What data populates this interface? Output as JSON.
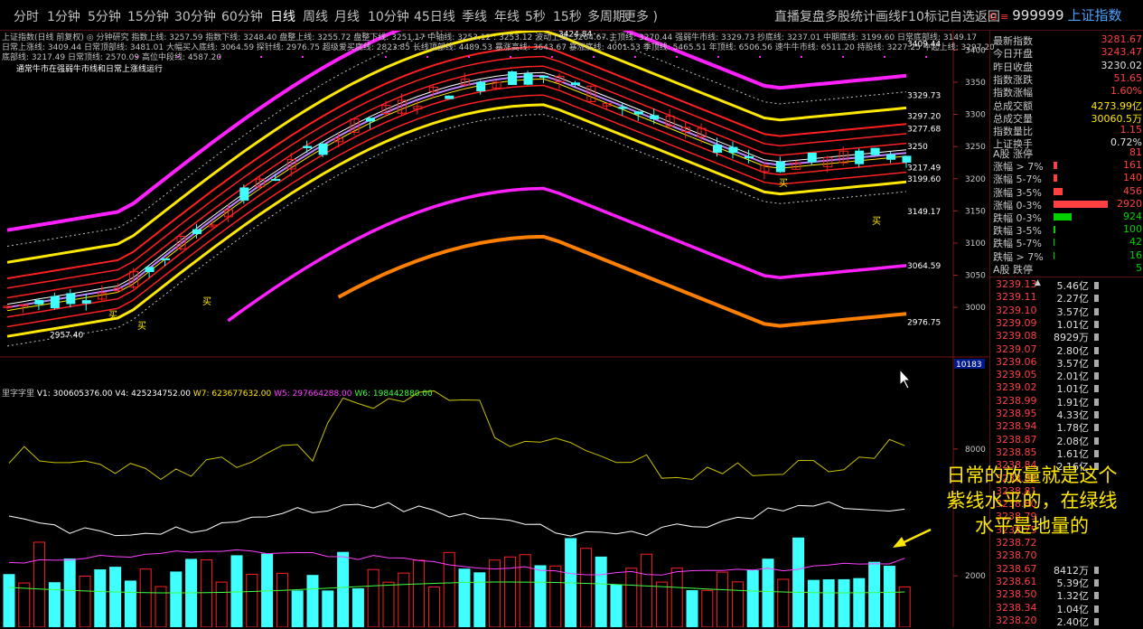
{
  "topbar": {
    "tabs": [
      "分时",
      "1分钟",
      "5分钟",
      "15分钟",
      "30分钟",
      "60分钟",
      "日线",
      "周线",
      "月线",
      "10分钟",
      "45日线",
      "季线",
      "年线",
      "5秒",
      "15秒",
      "多周期",
      "更多 )"
    ],
    "active_tab": "日线",
    "tools_text": "直播复盘多股统计画线F10标记自选返回"
  },
  "stock": {
    "flag": "G ≡",
    "code": "999999",
    "name": "上证指数"
  },
  "indicator": {
    "line1": "上证指数(日线 前复权) ◎ 分钟研究  指数上线: 3257.59  指数下线: 3248.40  盘整上线: 3255.72  盘整下线: 3251.17  中轴线: 3253.12 : 3253.12  波动上线: 3264.67  主顶线: 3270.44  强弱牛市线: 3329.73  抄底线: 3237.01  中期底线: 3199.60  日常底部线: 3149.17",
    "line2": "日常上涨线: 3409.44  日常顶部线: 3481.01  大幅买入底线: 3064.59  探针线: 2976.75  超级爱买底线: 2823.85  长线顶部线: 4489.53  暴涨高线: 3643.67  暴涨底线: 4001.53  季顶线: 5465.51  年顶线: 6506.56  速牛牛市线: 6511.20  持股线: 3227.25  牛起上线: 3297.20",
    "line3": "底部线: 3217.49  日常顶线: 2570.09  高位中段线: 4587.20",
    "note": "通常牛市在强弱牛市线和日常上涨线运行",
    "high_label": "3424.84",
    "low_label": "2957.40"
  },
  "volume_indicator": {
    "name": "里字字里",
    "v1": "V1: 300605376.00",
    "v4": "V4: 425234752.00",
    "w7": "W7: 623677632.00",
    "w5": "W5: 297664288.00",
    "w6": "W6: 198442880.00",
    "scale_box": "10183"
  },
  "price_levels": [
    "3409.44",
    "3329.73",
    "3297.20",
    "3277.68",
    "3250",
    "3217.49",
    "3199.60",
    "3149.17",
    "3064.59",
    "2976.75"
  ],
  "price_axis": [
    "3400",
    "3350",
    "3300",
    "3250",
    "3200",
    "3150",
    "3100",
    "3050",
    "3000"
  ],
  "vol_axis": [
    "8000",
    "2000"
  ],
  "right_panel": {
    "rows": [
      {
        "l": "最新指数",
        "v": "3281.67",
        "c": "#ff4040"
      },
      {
        "l": "今日开盘",
        "v": "3243.47",
        "c": "#ff4040"
      },
      {
        "l": "昨日收盘",
        "v": "3230.02",
        "c": "#e0e0e0"
      },
      {
        "l": "指数涨跌",
        "v": "51.65",
        "c": "#ff4040"
      },
      {
        "l": "指数涨幅",
        "v": "1.60%",
        "c": "#ff4040"
      },
      {
        "l": "总成交额",
        "v": "4273.99亿",
        "c": "#ffe800"
      },
      {
        "l": "总成交量",
        "v": "30060.5万",
        "c": "#ffe800"
      },
      {
        "l": "指数量比",
        "v": "1.15",
        "c": "#ff4040"
      },
      {
        "l": "上证换手",
        "v": "0.72%",
        "c": "#e0e0e0"
      }
    ],
    "breadth": [
      {
        "l": "A股 涨停",
        "v": "81",
        "c": "#ff4040",
        "w": 0
      },
      {
        "l": "涨幅 > 7%",
        "v": "161",
        "c": "#ff4040",
        "w": 4
      },
      {
        "l": "涨幅 5-7%",
        "v": "140",
        "c": "#ff4040",
        "w": 4
      },
      {
        "l": "涨幅 3-5%",
        "v": "456",
        "c": "#ff4040",
        "w": 10
      },
      {
        "l": "涨幅 0-3%",
        "v": "2920",
        "c": "#ff4040",
        "w": 60
      },
      {
        "l": "跌幅 0-3%",
        "v": "924",
        "c": "#00d000",
        "w": 20
      },
      {
        "l": "跌幅 3-5%",
        "v": "100",
        "c": "#00d000",
        "w": 2
      },
      {
        "l": "跌幅 5-7%",
        "v": "42",
        "c": "#00d000",
        "w": 1
      },
      {
        "l": "跌幅 > 7%",
        "v": "16",
        "c": "#00d000",
        "w": 1
      },
      {
        "l": "A股 跌停",
        "v": "5",
        "c": "#00d000",
        "w": 0
      }
    ],
    "ticks": [
      {
        "p": "3239.13",
        "a": "▲",
        "v": "5.46亿"
      },
      {
        "p": "3239.11",
        "a": "",
        "v": "2.27亿"
      },
      {
        "p": "3239.10",
        "a": "",
        "v": "3.57亿"
      },
      {
        "p": "3239.09",
        "a": "",
        "v": "1.01亿"
      },
      {
        "p": "3239.08",
        "a": "",
        "v": "8929万"
      },
      {
        "p": "3239.07",
        "a": "",
        "v": "2.80亿"
      },
      {
        "p": "3239.06",
        "a": "",
        "v": "3.57亿"
      },
      {
        "p": "3239.05",
        "a": "",
        "v": "2.01亿"
      },
      {
        "p": "3239.02",
        "a": "",
        "v": "1.01亿"
      },
      {
        "p": "3238.99",
        "a": "",
        "v": "1.91亿"
      },
      {
        "p": "3238.95",
        "a": "",
        "v": "4.33亿"
      },
      {
        "p": "3238.94",
        "a": "",
        "v": "1.78亿"
      },
      {
        "p": "3238.87",
        "a": "",
        "v": "2.08亿"
      },
      {
        "p": "3238.85",
        "a": "",
        "v": "1.61亿"
      },
      {
        "p": "3238.84",
        "a": "",
        "v": "2.16亿"
      },
      {
        "p": "3238.82",
        "a": "",
        "v": ""
      },
      {
        "p": "3238.81",
        "a": "",
        "v": ""
      },
      {
        "p": "3238.80",
        "a": "",
        "v": ""
      },
      {
        "p": "3238.79",
        "a": "",
        "v": ""
      },
      {
        "p": "3238.75",
        "a": "",
        "v": ""
      },
      {
        "p": "3238.72",
        "a": "",
        "v": ""
      },
      {
        "p": "3238.70",
        "a": "",
        "v": ""
      },
      {
        "p": "3238.67",
        "a": "",
        "v": "8412万"
      },
      {
        "p": "3238.61",
        "a": "",
        "v": "5.39亿"
      },
      {
        "p": "3238.50",
        "a": "",
        "v": "1.32亿"
      },
      {
        "p": "3238.34",
        "a": "",
        "v": "1.04亿"
      },
      {
        "p": "3238.20",
        "a": "",
        "v": "2.40亿"
      }
    ]
  },
  "annotation": "日常的放量就是这个紫线水平的，在绿线水平是地量的",
  "markers": [
    "买",
    "买",
    "买",
    "买",
    "买"
  ],
  "colors": {
    "up": "#ff2020",
    "down": "#40ffff",
    "yellow": "#ffe800",
    "magenta": "#ff20ff",
    "orange": "#ff8000",
    "purple": "#c080ff"
  }
}
